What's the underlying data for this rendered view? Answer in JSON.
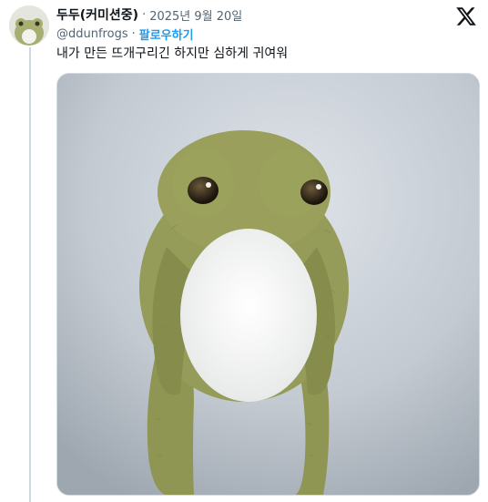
{
  "tweet": {
    "display_name": "두두(커미션중)",
    "separator": "·",
    "date": "2025년 9월 20일",
    "handle": "@ddunfrogs",
    "follow_separator": "·",
    "follow_label": "팔로우하기",
    "text": "내가 만든 뜨개구리긴 하지만 심하게 귀여워"
  },
  "icons": {
    "brand": "x-logo-icon",
    "avatar": "frog-avatar"
  },
  "colors": {
    "link": "#1d9bf0",
    "text": "#0f1419",
    "muted": "#536471"
  }
}
